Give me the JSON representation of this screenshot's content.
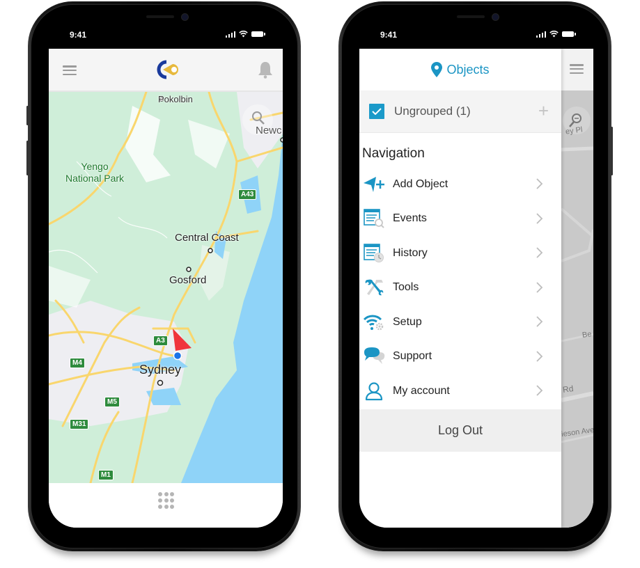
{
  "left_phone": {
    "status_bar": {
      "time": "9:41"
    },
    "header": {
      "logo": "app-logo",
      "menu_icon": "hamburger-icon",
      "notification_icon": "bell-icon"
    },
    "map": {
      "labels": {
        "pokolbin": "Pokolbin",
        "newcastle": "Newc",
        "yengo_line1": "Yengo",
        "yengo_line2": "National Park",
        "central_coast": "Central Coast",
        "gosford": "Gosford",
        "sydney": "Sydney"
      },
      "road_shields": {
        "a43": "A43",
        "a3": "A3",
        "m4": "M4",
        "m5": "M5",
        "m31": "M31",
        "m1": "M1"
      },
      "marker_color": "#f0343c",
      "location_dot_color": "#1a73e8"
    },
    "bottom_bar": {
      "menu_icon": "apps-grid-icon"
    }
  },
  "right_phone": {
    "status_bar": {
      "time": "9:41"
    },
    "drawer": {
      "header_title": "Objects",
      "group": {
        "label": "Ungrouped (1)",
        "checked": true
      },
      "section_title": "Navigation",
      "items": [
        {
          "label": "Add Object",
          "icon": "add-object-icon"
        },
        {
          "label": "Events",
          "icon": "events-icon"
        },
        {
          "label": "History",
          "icon": "history-icon"
        },
        {
          "label": "Tools",
          "icon": "tools-icon"
        },
        {
          "label": "Setup",
          "icon": "setup-icon"
        },
        {
          "label": "Support",
          "icon": "support-icon"
        },
        {
          "label": "My account",
          "icon": "account-icon"
        }
      ],
      "logout_label": "Log Out"
    },
    "background_map_labels": {
      "street1": "ey Pl",
      "street2": "Be",
      "street3": "Rd",
      "street4": "ieson Ave"
    },
    "accent_color": "#1b95c4"
  }
}
